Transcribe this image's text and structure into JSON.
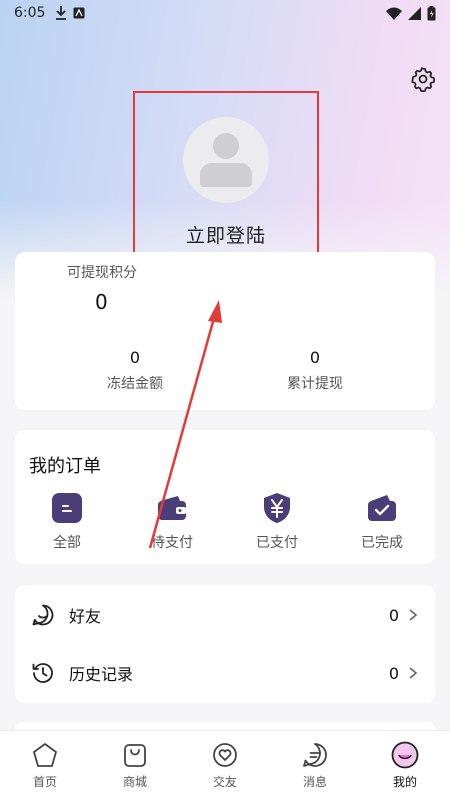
{
  "status_bar": {
    "time": "6:05"
  },
  "header": {
    "login_label": "立即登陆"
  },
  "balance": {
    "withdrawable_label": "可提现积分",
    "withdrawable_value": "0",
    "frozen_value": "0",
    "frozen_label": "冻结金额",
    "total_withdrawn_value": "0",
    "total_withdrawn_label": "累计提现"
  },
  "orders": {
    "title": "我的订单",
    "items": [
      {
        "label": "全部",
        "icon": "all-orders-icon"
      },
      {
        "label": "待支付",
        "icon": "wallet-icon"
      },
      {
        "label": "已支付",
        "icon": "yen-shield-icon"
      },
      {
        "label": "已完成",
        "icon": "completed-check-icon"
      }
    ]
  },
  "menu": [
    {
      "label": "好友",
      "count": "0",
      "icon": "friend-smile-icon"
    },
    {
      "label": "历史记录",
      "count": "0",
      "icon": "history-icon"
    }
  ],
  "tabbar": [
    {
      "label": "首页",
      "icon": "home-icon"
    },
    {
      "label": "商城",
      "icon": "shop-bag-icon"
    },
    {
      "label": "交友",
      "icon": "heart-chat-icon"
    },
    {
      "label": "消息",
      "icon": "message-icon"
    },
    {
      "label": "我的",
      "icon": "profile-face-icon",
      "active": true
    }
  ],
  "colors": {
    "accent_purple": "#4a3d78",
    "annotation_red": "#e53a3a"
  }
}
